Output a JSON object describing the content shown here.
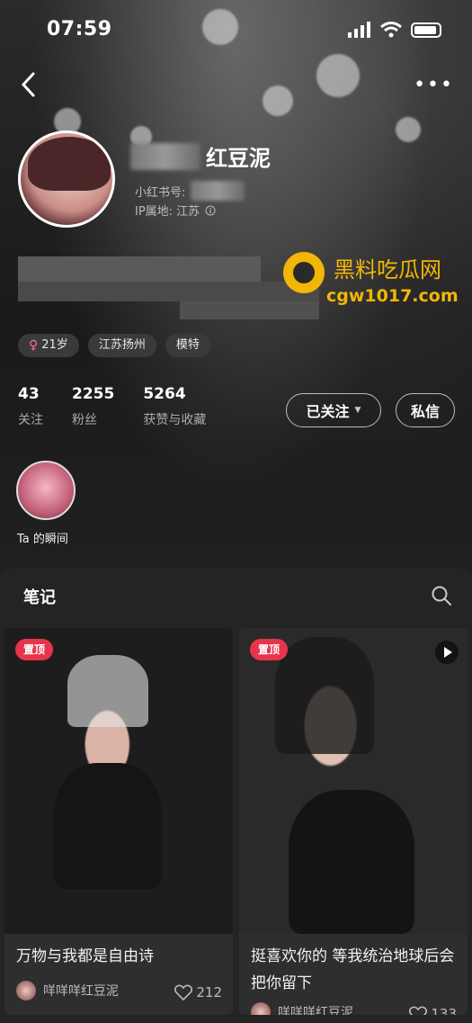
{
  "status_bar": {
    "time": "07:59"
  },
  "profile": {
    "name": "红豆泥",
    "id_label": "小红书号:",
    "ip_label": "IP属地: 江苏",
    "tags": [
      "21岁",
      "江苏扬州",
      "模特"
    ],
    "stats": [
      {
        "value": "43",
        "label": "关注"
      },
      {
        "value": "2255",
        "label": "粉丝"
      },
      {
        "value": "5264",
        "label": "获赞与收藏"
      }
    ],
    "follow_button": "已关注",
    "message_button": "私信",
    "moment_label": "Ta 的瞬间"
  },
  "watermark": {
    "line1": "黑料吃瓜网",
    "line2": "cgw1017.com"
  },
  "notes": {
    "title": "笔记",
    "cards": [
      {
        "pin": "置顶",
        "title": "万物与我都是自由诗",
        "author": "咩咩咩红豆泥",
        "likes": "212"
      },
      {
        "pin": "置顶",
        "title": "挺喜欢你的 等我统治地球后会把你留下",
        "author": "咩咩咩红豆泥",
        "likes": "133"
      }
    ]
  },
  "colors": {
    "accent": "#e8344b",
    "watermark": "#f2b705",
    "background": "#1e1e1e"
  }
}
